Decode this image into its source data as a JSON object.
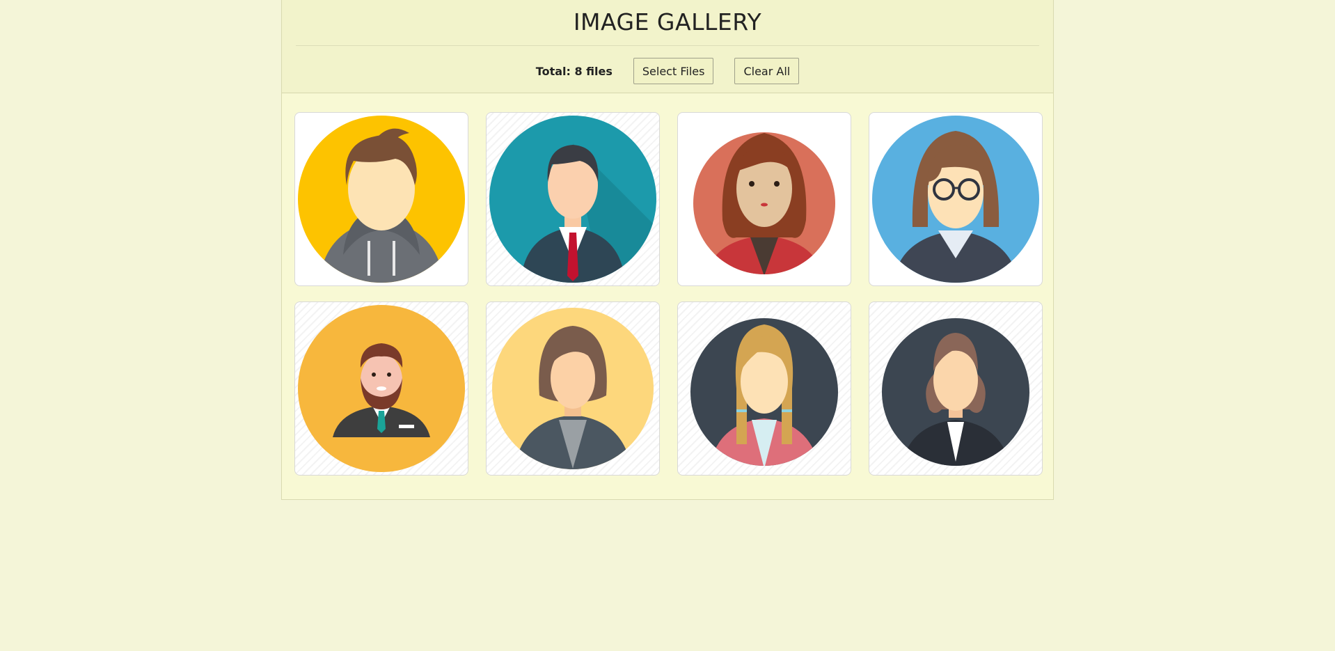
{
  "header": {
    "title": "IMAGE GALLERY",
    "total_label": "Total: 8 files",
    "select_button": "Select Files",
    "clear_button": "Clear All"
  },
  "gallery": {
    "images": [
      {
        "icon": "avatar-man-hoodie-icon",
        "background": "#fdc300"
      },
      {
        "icon": "avatar-man-suit-red-tie-icon",
        "background": "#1c9aab"
      },
      {
        "icon": "avatar-woman-red-hair-icon",
        "background": "#d9705a"
      },
      {
        "icon": "avatar-woman-glasses-icon",
        "background": "#59b0e0"
      },
      {
        "icon": "avatar-man-beard-icon",
        "background": "#f7b73d"
      },
      {
        "icon": "avatar-woman-blazer-icon",
        "background": "#fdd77c"
      },
      {
        "icon": "avatar-girl-braids-icon",
        "background": "#3c4651"
      },
      {
        "icon": "avatar-woman-bun-icon",
        "background": "#3c4651"
      }
    ]
  }
}
